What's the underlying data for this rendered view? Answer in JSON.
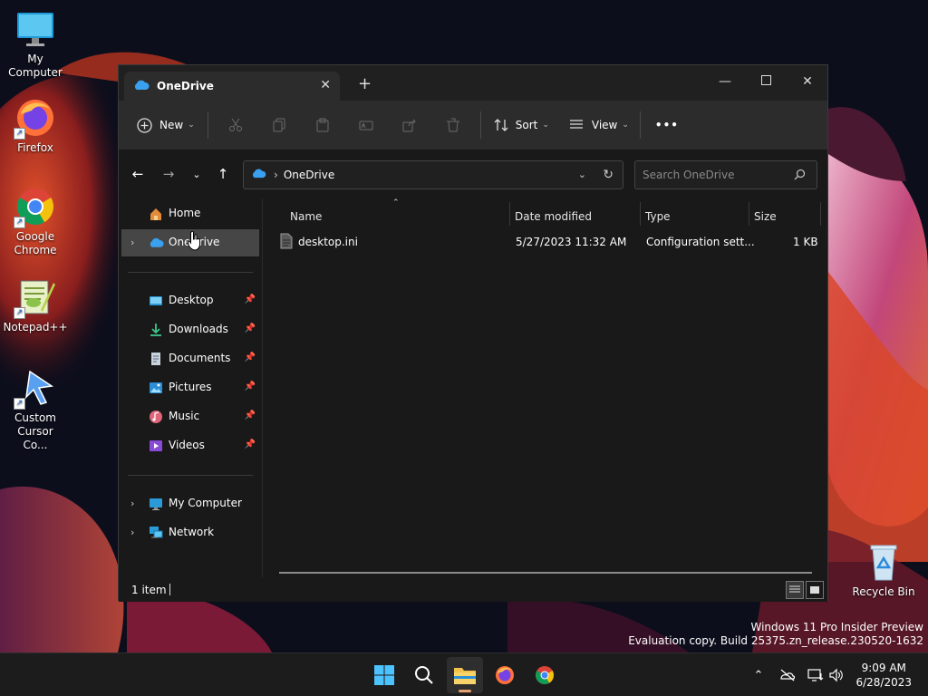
{
  "desktop": {
    "icons": [
      {
        "label": "My Computer",
        "icon": "monitor-icon"
      },
      {
        "label": "Firefox",
        "icon": "firefox-icon"
      },
      {
        "label": "Google Chrome",
        "icon": "chrome-icon"
      },
      {
        "label": "Notepad++",
        "icon": "notepadpp-icon"
      },
      {
        "label": "Custom Cursor Co...",
        "icon": "cursor-app-icon"
      },
      {
        "label": "Recycle Bin",
        "icon": "recycle-bin-icon"
      }
    ],
    "watermark": {
      "line1": "Windows 11 Pro Insider Preview",
      "line2": "Evaluation copy. Build 25375.zn_release.230520-1632"
    }
  },
  "explorer": {
    "tab_title": "OneDrive",
    "toolbar": {
      "new_label": "New",
      "sort_label": "Sort",
      "view_label": "View",
      "more_label": "•••"
    },
    "address": {
      "path": "OneDrive"
    },
    "search": {
      "placeholder": "Search OneDrive"
    },
    "nav": {
      "home": "Home",
      "onedrive": "OneDrive",
      "desktop": "Desktop",
      "downloads": "Downloads",
      "documents": "Documents",
      "pictures": "Pictures",
      "music": "Music",
      "videos": "Videos",
      "my_computer": "My Computer",
      "network": "Network"
    },
    "columns": {
      "name": "Name",
      "date": "Date modified",
      "type": "Type",
      "size": "Size"
    },
    "files": [
      {
        "name": "desktop.ini",
        "date": "5/27/2023 11:32 AM",
        "type": "Configuration sett...",
        "size": "1 KB"
      }
    ],
    "status": {
      "count": "1 item"
    }
  },
  "taskbar": {
    "time": "9:09 AM",
    "date": "6/28/2023"
  },
  "colors": {
    "accent": "#0078d4",
    "folder": "#f2c14e"
  }
}
